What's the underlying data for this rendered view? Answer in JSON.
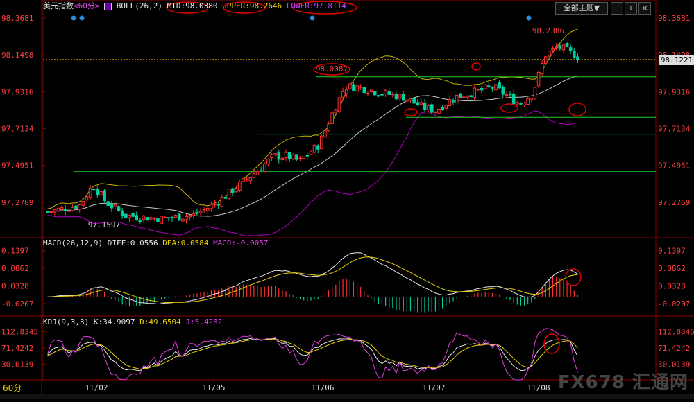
{
  "header": {
    "symbol": "美元指数",
    "period_tag": "<60分>",
    "indicator": "BOLL(26,2)",
    "mid": "MID:98.0380",
    "upper": "UPPER:98.2646",
    "lower": "LOWER:97.8114",
    "theme_button": "全部主题▼"
  },
  "macd_header": {
    "name": "MACD(26,12,9)",
    "diff": "DIFF:0.0556",
    "dea": "DEA:0.0584",
    "macd": "MACD:-0.0057"
  },
  "kdj_header": {
    "name": "KDJ(9,3,3)",
    "k": "K:34.9097",
    "d": "D:49.6504",
    "j": "J:5.4282"
  },
  "period_label": "60分",
  "current_price": "98.1221",
  "watermark": "FX678 汇通网",
  "colors": {
    "up": "#ff3030",
    "down": "#00d0a0",
    "mid": "#c8c8c8",
    "upper": "#c8b400",
    "lower": "#b000c0",
    "support": "#20d020",
    "annotation": "#e00000",
    "axis_text": "#ff4040"
  },
  "chart_data": [
    {
      "type": "candlestick",
      "title": "美元指数 60分 BOLL(26,2)",
      "y_axis_ticks": [
        "98.3681",
        "98.1498",
        "97.9316",
        "97.7134",
        "97.4951",
        "97.2769"
      ],
      "ylim": [
        97.08,
        98.4
      ],
      "x_tick_labels": [
        "11/02",
        "11/05",
        "11/06",
        "11/07",
        "11/08"
      ],
      "annotations": [
        "98.2386",
        "98.0087",
        "97.1597"
      ],
      "horizontal_levels": [
        98.02,
        97.78,
        97.68,
        97.46
      ],
      "last_price": 98.1221,
      "series_names": [
        "MID",
        "UPPER",
        "LOWER"
      ]
    },
    {
      "type": "bar+line",
      "title": "MACD(26,12,9)",
      "y_axis_ticks": [
        "0.1397",
        "0.0862",
        "0.0328",
        "-0.0207"
      ],
      "ylim": [
        -0.05,
        0.16
      ],
      "series_names": [
        "DIFF",
        "DEA",
        "MACD"
      ]
    },
    {
      "type": "line",
      "title": "KDJ(9,3,3)",
      "y_axis_ticks": [
        "112.8345",
        "71.4242",
        "30.0139"
      ],
      "ylim": [
        -10,
        135
      ],
      "series_names": [
        "K",
        "D",
        "J"
      ]
    }
  ]
}
